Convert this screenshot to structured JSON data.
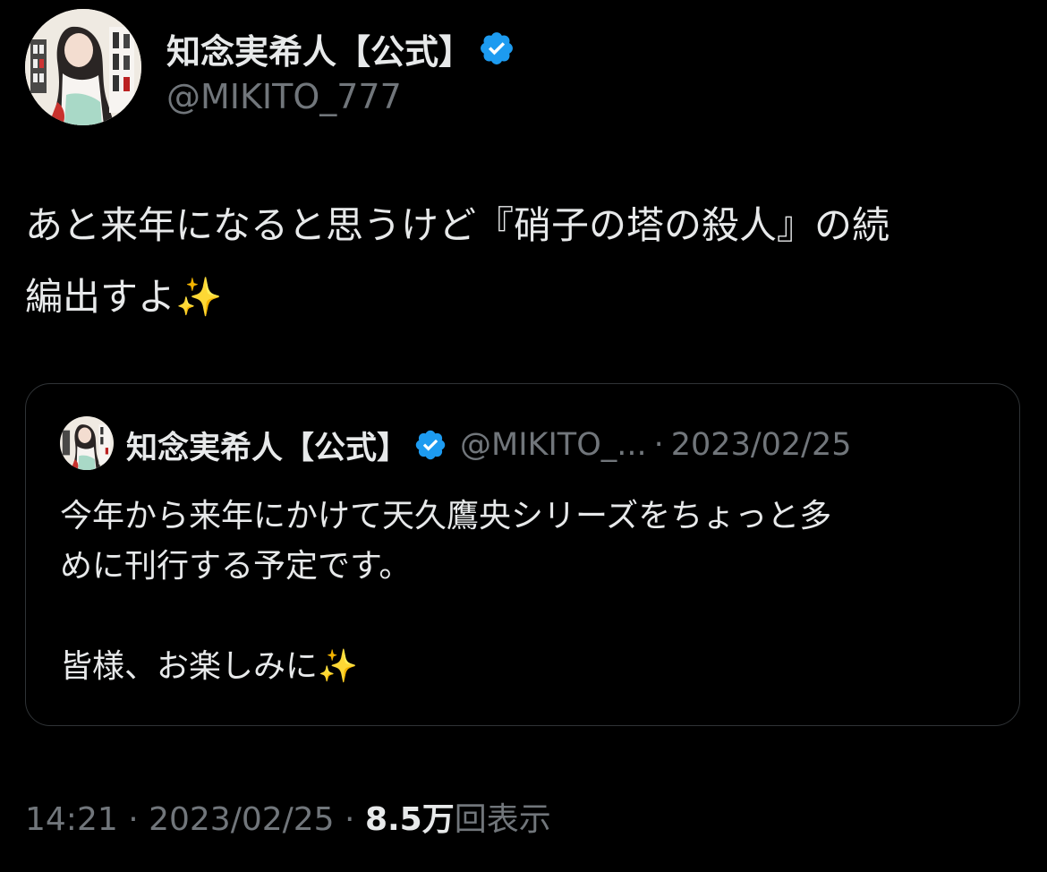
{
  "author": {
    "display_name": "知念実希人【公式】",
    "handle": "@MIKITO_777",
    "avatar_icon": "book-cover-avatar-icon",
    "verified_icon": "verified-badge-icon",
    "verified_color": "#1d9bf0"
  },
  "tweet": {
    "line1": "あと来年になると思うけど『硝子の塔の殺人』の続",
    "line2": "編出すよ✨"
  },
  "quote": {
    "display_name": "知念実希人【公式】",
    "handle": "@MIKITO_...",
    "separator": "·",
    "date": "2023/02/25",
    "line1": "今年から来年にかけて天久鷹央シリーズをちょっと多",
    "line2": "めに刊行する予定です。",
    "line3": "",
    "line4": "皆様、お楽しみに✨"
  },
  "meta": {
    "time": "14:21",
    "sep1": " · ",
    "date": "2023/02/25",
    "sep2": " · ",
    "views_count": "8.5万",
    "views_label": "回表示"
  }
}
